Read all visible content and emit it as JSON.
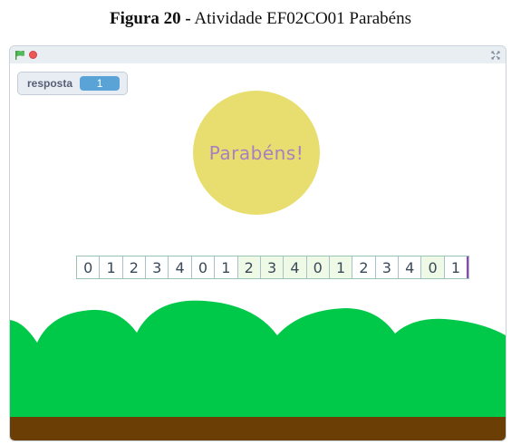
{
  "caption": {
    "figure_label": "Figura 20 -",
    "description": "Atividade EF02CO01 Parabéns"
  },
  "player": {
    "flag_icon": "green-flag-icon",
    "stop_icon": "stop-icon",
    "fullscreen_icon": "fullscreen-icon"
  },
  "variable_monitor": {
    "name": "resposta",
    "value": "1"
  },
  "speech_bubble": {
    "text": "Parabéns!",
    "color": "#e8de6f"
  },
  "number_line": {
    "digits": [
      "0",
      "1",
      "2",
      "3",
      "4",
      "0",
      "1",
      "2",
      "3",
      "4",
      "0",
      "1",
      "2",
      "3",
      "4",
      "0",
      "1"
    ]
  },
  "colors": {
    "grass": "#00c94a",
    "ground": "#6b3e06",
    "bubble": "#e8de6f",
    "monitor_value": "#5aa3d6"
  }
}
